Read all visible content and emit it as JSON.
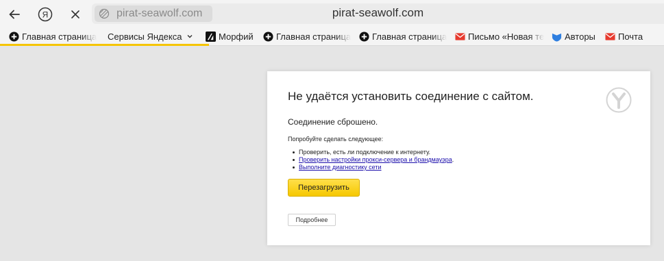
{
  "toolbar": {
    "back_icon": "arrow-left-icon",
    "yandex_icon": "yandex-ya-icon",
    "stop_icon": "close-icon",
    "url_chip_text": "pirat-seawolf.com",
    "url_title": "pirat-seawolf.com"
  },
  "bookmarks": {
    "items": [
      {
        "label": "Главная страница",
        "icon": "plus-circle-icon"
      },
      {
        "label": "Сервисы Яндекса",
        "icon": "chevron-down-icon"
      },
      {
        "label": "Морфий",
        "icon": "morfiy-logo-icon"
      },
      {
        "label": "Главная страница",
        "icon": "plus-circle-icon"
      },
      {
        "label": "Главная страница",
        "icon": "plus-circle-icon"
      },
      {
        "label": "Письмо «Новая те",
        "icon": "mail-icon"
      },
      {
        "label": "Авторы",
        "icon": "shield-icon"
      },
      {
        "label": "Почта",
        "icon": "mail-icon"
      }
    ],
    "more_icon": "more-vertical-icon"
  },
  "error": {
    "title": "Не удаётся установить соединение с сайтом.",
    "message": "Соединение сброшено.",
    "try_label": "Попробуйте сделать следующее:",
    "suggestions": [
      "Проверить, есть ли подключение к интернету.",
      "Проверить настройки прокси-сервера и брандмауэра",
      "Выполните диагностику сети"
    ],
    "reload_label": "Перезагрузить",
    "details_label": "Подробнее",
    "logo_icon": "yandex-browser-logo-icon"
  },
  "colors": {
    "accent_yellow": "#f6c800",
    "link_blue": "#1a0dab",
    "mail_red": "#e63a2e",
    "shield_blue": "#2f7fe0"
  }
}
